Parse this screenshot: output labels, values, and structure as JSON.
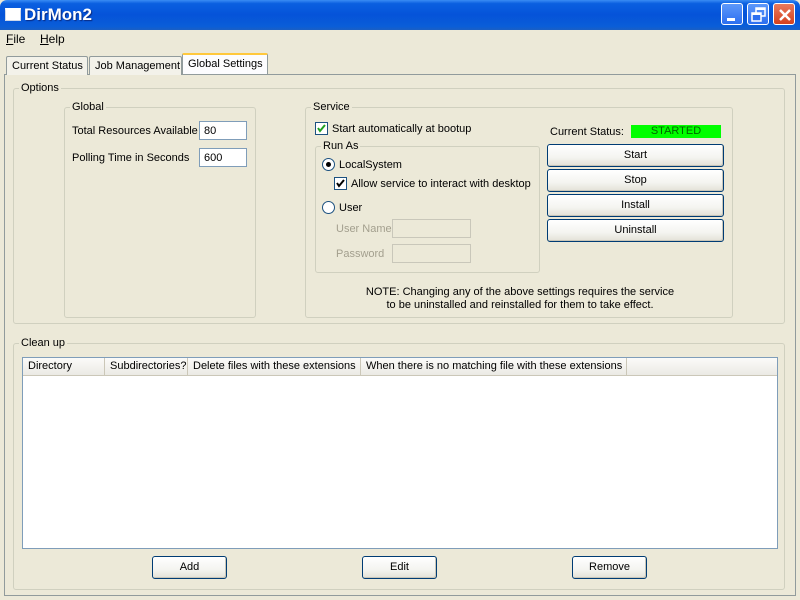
{
  "window": {
    "title": "DirMon2",
    "controls": [
      "minimize-icon",
      "restore-icon",
      "close-icon"
    ]
  },
  "menu": {
    "file": "File",
    "help": "Help"
  },
  "tabs": [
    {
      "label": "Current Status"
    },
    {
      "label": "Job Management"
    },
    {
      "label": "Global Settings",
      "active": true
    }
  ],
  "options": {
    "label": "Options",
    "global": {
      "label": "Global",
      "total_resources_label": "Total Resources Available",
      "total_resources_value": "80",
      "polling_time_label": "Polling Time in Seconds",
      "polling_time_value": "600"
    },
    "service": {
      "label": "Service",
      "start_auto_label": "Start automatically at bootup",
      "start_auto_checked": true,
      "run_as": {
        "label": "Run As",
        "local_system_label": "LocalSystem",
        "local_system_selected": true,
        "interact_desktop_label": "Allow service to interact with desktop",
        "interact_desktop_checked": true,
        "user_label": "User",
        "user_name_label": "User Name",
        "password_label": "Password"
      },
      "current_status_label": "Current Status:",
      "current_status_value": "STARTED",
      "status_color": "#00ff00",
      "buttons": {
        "start": "Start",
        "stop": "Stop",
        "install": "Install",
        "uninstall": "Uninstall"
      },
      "note_line1": "NOTE: Changing any of the above settings requires the service",
      "note_line2": "to be uninstalled and reinstalled for them to take effect."
    }
  },
  "cleanup": {
    "label": "Clean up",
    "columns": [
      "Directory",
      "Subdirectories?",
      "Delete files with these extensions",
      "When there is no matching file with these extensions"
    ],
    "rows": [],
    "buttons": {
      "add": "Add",
      "edit": "Edit",
      "remove": "Remove"
    }
  }
}
